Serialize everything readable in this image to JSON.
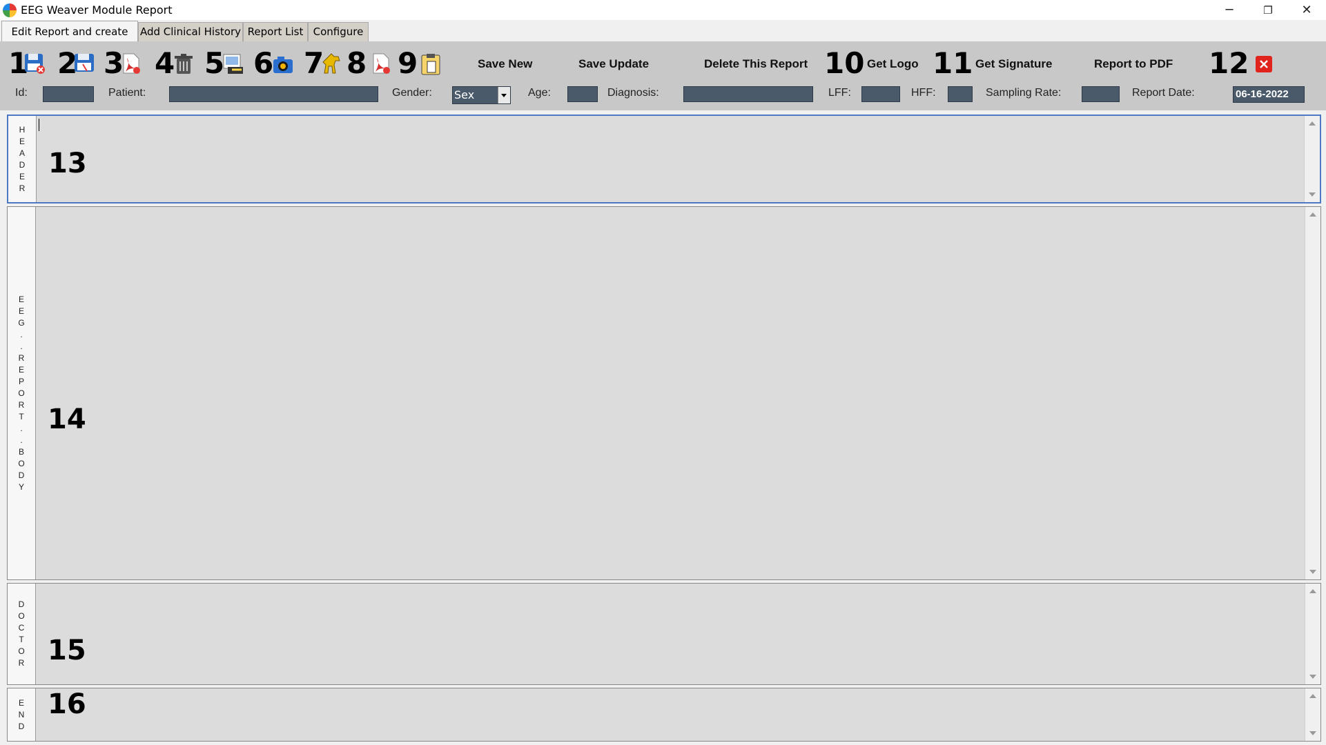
{
  "window": {
    "title": "EEG Weaver Module Report",
    "controls": {
      "minimize": "─",
      "restore": "❐",
      "close": "✕"
    }
  },
  "tabs": [
    {
      "label": "Edit Report and create PDF",
      "active": true
    },
    {
      "label": "Add Clinical History",
      "active": false
    },
    {
      "label": "Report List",
      "active": false
    },
    {
      "label": "Configure",
      "active": false
    }
  ],
  "toolbar": {
    "numbers": [
      "1",
      "2",
      "3",
      "4",
      "5",
      "6",
      "7",
      "8",
      "9",
      "10",
      "11",
      "12"
    ],
    "icons": [
      "save-delete-icon",
      "save-icon",
      "pdf-icon",
      "trash-icon",
      "image-edit-icon",
      "camera-icon",
      "horse-icon",
      "pdf-icon",
      "clipboard-icon",
      "close-icon"
    ],
    "save_new": "Save New",
    "save_update": "Save Update",
    "delete_report": "Delete This Report",
    "get_logo": "Get Logo",
    "get_signature": "Get Signature",
    "report_to_pdf": "Report to PDF"
  },
  "fields": {
    "id_label": "Id:",
    "id_value": "",
    "patient_label": "Patient:",
    "patient_value": "",
    "gender_label": "Gender:",
    "gender_value": "Sex",
    "age_label": "Age:",
    "age_value": "",
    "diagnosis_label": "Diagnosis:",
    "diagnosis_value": "",
    "lff_label": "LFF:",
    "lff_value": "",
    "hff_label": "HFF:",
    "hff_value": "",
    "sampling_rate_label": "Sampling Rate:",
    "sampling_rate_value": "",
    "report_date_label": "Report Date:",
    "report_date_value": "06-16-2022"
  },
  "sections": {
    "header": {
      "label": "H\nE\nA\nD\nE\nR",
      "number": "13"
    },
    "body": {
      "label": "E\nE\nG\n.\n.\nR\nE\nP\nO\nR\nT\n.\n.\nB\nO\nD\nY",
      "number": "14"
    },
    "doctor": {
      "label": "D\nO\nC\nT\nO\nR",
      "number": "15"
    },
    "end": {
      "label": "E\nN\nD",
      "number": "16"
    }
  },
  "colors": {
    "toolbar_bg": "#c8c8c8",
    "input_bg": "#4a5a6b",
    "section_bg": "#dcdcdc",
    "selected_border": "#4a78c2",
    "close_red": "#e0231c"
  }
}
